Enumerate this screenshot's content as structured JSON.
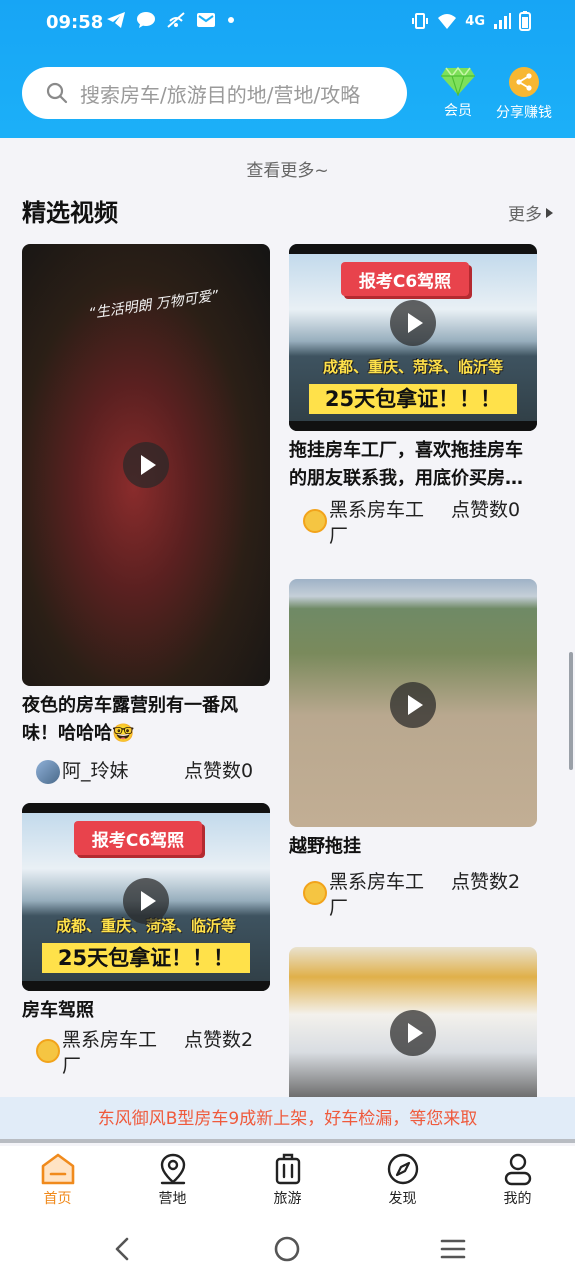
{
  "status_bar": {
    "time": "09:58",
    "network": "4G"
  },
  "header": {
    "search_placeholder": "搜索房车/旅游目的地/营地/攻略",
    "member_label": "会员",
    "share_label": "分享赚钱"
  },
  "content": {
    "see_more": "查看更多~",
    "section_title": "精选视频",
    "section_more": "更多"
  },
  "videos": [
    {
      "title": "夜色的房车露营别有一番风味！哈哈哈🤓",
      "author": "阿_玲妹",
      "likes": "点赞数0",
      "overlay_text": "“生活明朗 万物可爱”"
    },
    {
      "title": "拖挂房车工厂，喜欢拖挂房车的朋友联系我，用底价买房…",
      "author": "黑系房车工厂",
      "likes": "点赞数0",
      "poster": {
        "tag": "报考C6驾照",
        "cities": "成都、重庆、菏泽、临沂等",
        "days": "25天包拿证！！！"
      }
    },
    {
      "title": "越野拖挂",
      "author": "黑系房车工厂",
      "likes": "点赞数2"
    },
    {
      "title": "房车驾照",
      "author": "黑系房车工厂",
      "likes": "点赞数2",
      "poster": {
        "tag": "报考C6驾照",
        "cities": "成都、重庆、菏泽、临沂等",
        "days": "25天包拿证！！！"
      }
    }
  ],
  "banner": "东风御风B型房车9成新上架，好车检漏，等您来取",
  "tabs": [
    {
      "label": "首页",
      "icon": "home-icon",
      "active": true
    },
    {
      "label": "营地",
      "icon": "location-pin-icon"
    },
    {
      "label": "旅游",
      "icon": "luggage-icon"
    },
    {
      "label": "发现",
      "icon": "compass-icon"
    },
    {
      "label": "我的",
      "icon": "user-icon"
    }
  ],
  "colors": {
    "header_blue": "#1cb0f8",
    "accent_orange": "#f08a1c",
    "banner_text": "#ef5a3c"
  }
}
